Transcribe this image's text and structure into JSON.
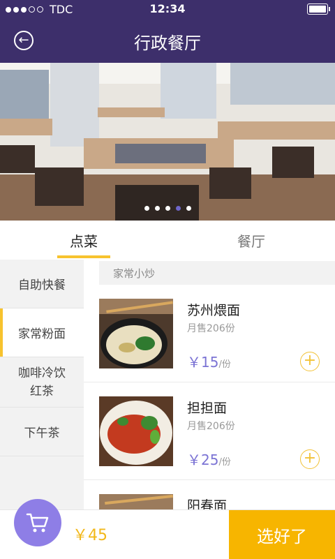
{
  "status": {
    "carrier": "TDC",
    "time": "12:34"
  },
  "header": {
    "title": "行政餐厅"
  },
  "hero": {
    "slides": 5,
    "active_slide": 4
  },
  "tabs": [
    {
      "label": "点菜",
      "active": true
    },
    {
      "label": "餐厅",
      "active": false
    }
  ],
  "sidebar": {
    "items": [
      {
        "label": "自助快餐",
        "active": false
      },
      {
        "label": "家常粉面",
        "active": true
      },
      {
        "label": "咖啡冷饮\n红茶",
        "active": false
      },
      {
        "label": "下午茶",
        "active": false
      }
    ]
  },
  "section": {
    "title": "家常小炒"
  },
  "dishes": [
    {
      "name": "苏州煨面",
      "sales": "月售206份",
      "price": "￥15",
      "unit": "/份"
    },
    {
      "name": "担担面",
      "sales": "月售206份",
      "price": "￥25",
      "unit": "/份"
    },
    {
      "name": "阳春面",
      "sales": "",
      "price": "",
      "unit": ""
    }
  ],
  "cart": {
    "total": "￥45",
    "confirm_label": "选好了"
  },
  "colors": {
    "header": "#3d2f6b",
    "accent": "#f7c32e",
    "price": "#7b73d4",
    "cart": "#8e7ee6",
    "confirm": "#f7b500"
  }
}
